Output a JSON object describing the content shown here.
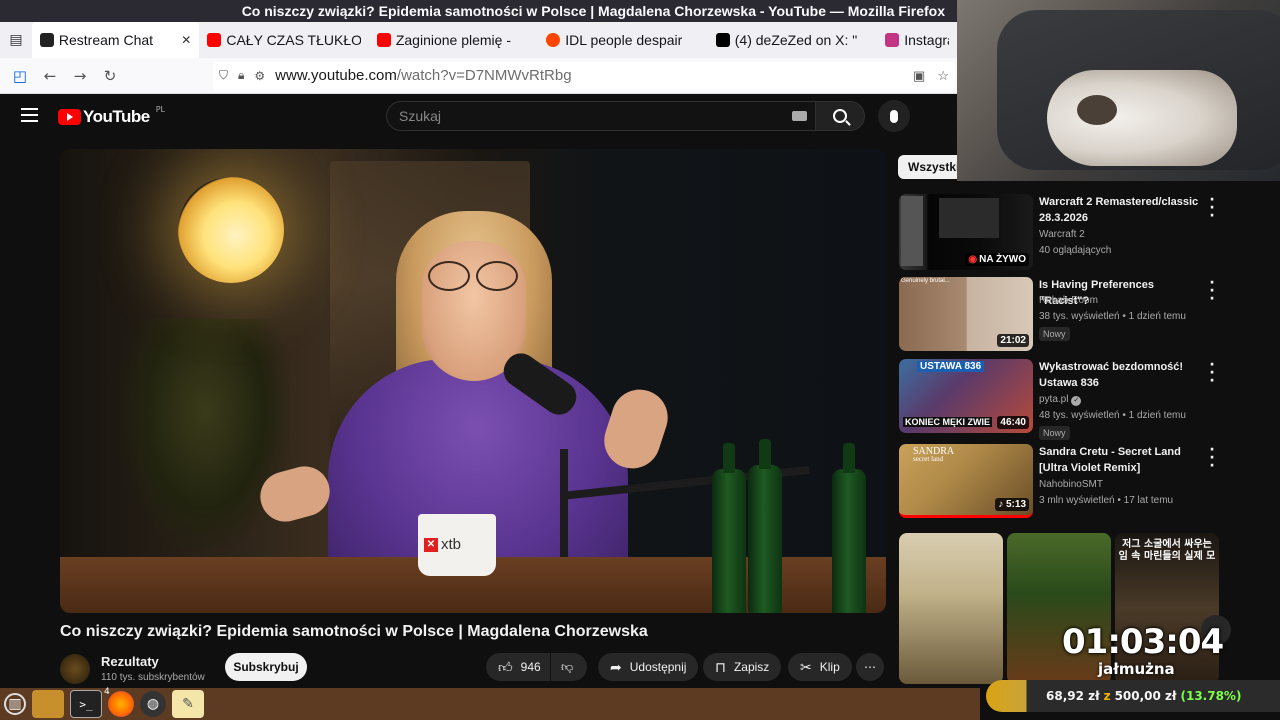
{
  "window": {
    "title": "Co niszczy związki? Epidemia samotności w Polsce | Magdalena Chorzewska - YouTube — Mozilla Firefox"
  },
  "browser": {
    "tabs": [
      {
        "label": "Restream Chat",
        "icon": "restream-icon",
        "color": "#222222",
        "active": true
      },
      {
        "label": "CAŁY CZAS TŁUKŁO",
        "icon": "youtube-icon",
        "color": "#ff0000",
        "active": false
      },
      {
        "label": "Zaginione plemię -",
        "icon": "youtube-icon",
        "color": "#ff0000",
        "active": false
      },
      {
        "label": "IDL people despair",
        "icon": "reddit-icon",
        "color": "#ff4500",
        "active": false
      },
      {
        "label": "(4) deZeZed on X: \"",
        "icon": "x-icon",
        "color": "#000000",
        "active": false
      },
      {
        "label": "Instagra",
        "icon": "instagram-icon",
        "color": "#c13584",
        "active": false
      }
    ],
    "url_host": "www.youtube.com",
    "url_path": "/watch?v=D7NMWvRtRbg"
  },
  "youtube": {
    "logo_text": "YouTube",
    "country_code": "PL",
    "search_placeholder": "Szukaj",
    "video": {
      "title": "Co niszczy związki? Epidemia samotności w Polsce | Magdalena Chorzewska",
      "mug_brand": "xtb",
      "channel_name": "Rezultaty",
      "channel_subs": "110 tys. subskrybentów",
      "subscribe_label": "Subskrybuj",
      "likes": "946",
      "share_label": "Udostępnij",
      "save_label": "Zapisz",
      "clip_label": "Klip"
    },
    "sidebar": {
      "chip_label": "Wszystkie",
      "recommendations": [
        {
          "title": "Warcraft 2 Remastered/classic 28.3.2026",
          "channel": "Warcraft 2",
          "meta": "40 oglądających",
          "live_label": "NA ŻYWO",
          "duration": "",
          "badge": ""
        },
        {
          "title": "Is Having Preferences \"Racist\"?",
          "channel": "Rehab Room",
          "meta": "38 tys. wyświetleń • 1 dzień temu",
          "live_label": "",
          "duration": "21:02",
          "badge": "Nowy",
          "thumb_caption": "Genuinely brutal..."
        },
        {
          "title": "Wykastrować bezdomność! Ustawa 836",
          "channel": "pyta.pl",
          "meta": "48 tys. wyświetleń • 1 dzień temu",
          "live_label": "",
          "duration": "46:40",
          "badge": "Nowy",
          "thumb_top": "USTAWA 836",
          "thumb_bottom": "KONIEC MĘKI ZWIE"
        },
        {
          "title": "Sandra Cretu - Secret Land [Ultra Violet Remix]",
          "channel": "NahobinoSMT",
          "meta": "3 mln wyświetleń • 17 lat temu",
          "live_label": "",
          "duration": "5:13",
          "badge": "",
          "thumb_top": "SANDRA",
          "thumb_sub": "secret land"
        }
      ],
      "shorts": [
        {
          "caption": ""
        },
        {
          "caption": ""
        },
        {
          "caption": "저그 소굴에서 싸우는 임 속 마린들의 실제 모"
        }
      ]
    }
  },
  "overlay": {
    "timer": "01:03:04",
    "timer_label": "jałmużna",
    "donation_current": "68,92 zł",
    "donation_of": "z",
    "donation_goal": "500,00 zł",
    "donation_pct": "(13.78%)",
    "donation_fraction": 0.1378
  },
  "taskbar": {
    "items": [
      "menu-icon",
      "folder-icon",
      "terminal-icon",
      "firefox-icon",
      "obs-icon",
      "notes-icon"
    ],
    "firefox_count": "4"
  }
}
